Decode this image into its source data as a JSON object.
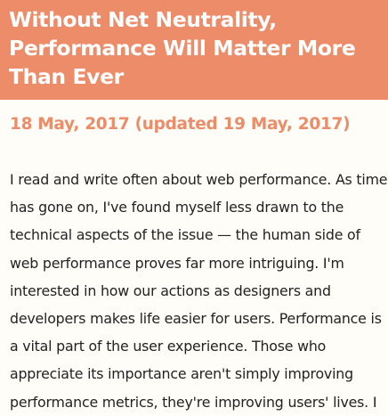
{
  "header": {
    "title": "Without Net Neutrality,\nPerformance Will Matter More\nThan Ever"
  },
  "post": {
    "date": "18 May, 2017 (updated 19 May, 2017)",
    "body_lines": [
      "I read and write often about web performance. As time",
      "has gone on, I've found myself less drawn to the",
      "technical aspects of the issue — the human side of",
      "web performance proves far more intriguing. I'm",
      "interested in how our actions as designers and",
      "developers makes life easier for users. Performance is",
      "a vital part of the user experience. Those who",
      "appreciate its importance aren't simply improving",
      "performance metrics, they're improving users' lives. I"
    ]
  },
  "colors": {
    "accent": "#ec8c69",
    "background": "#fffdf7",
    "text": "#222222"
  }
}
